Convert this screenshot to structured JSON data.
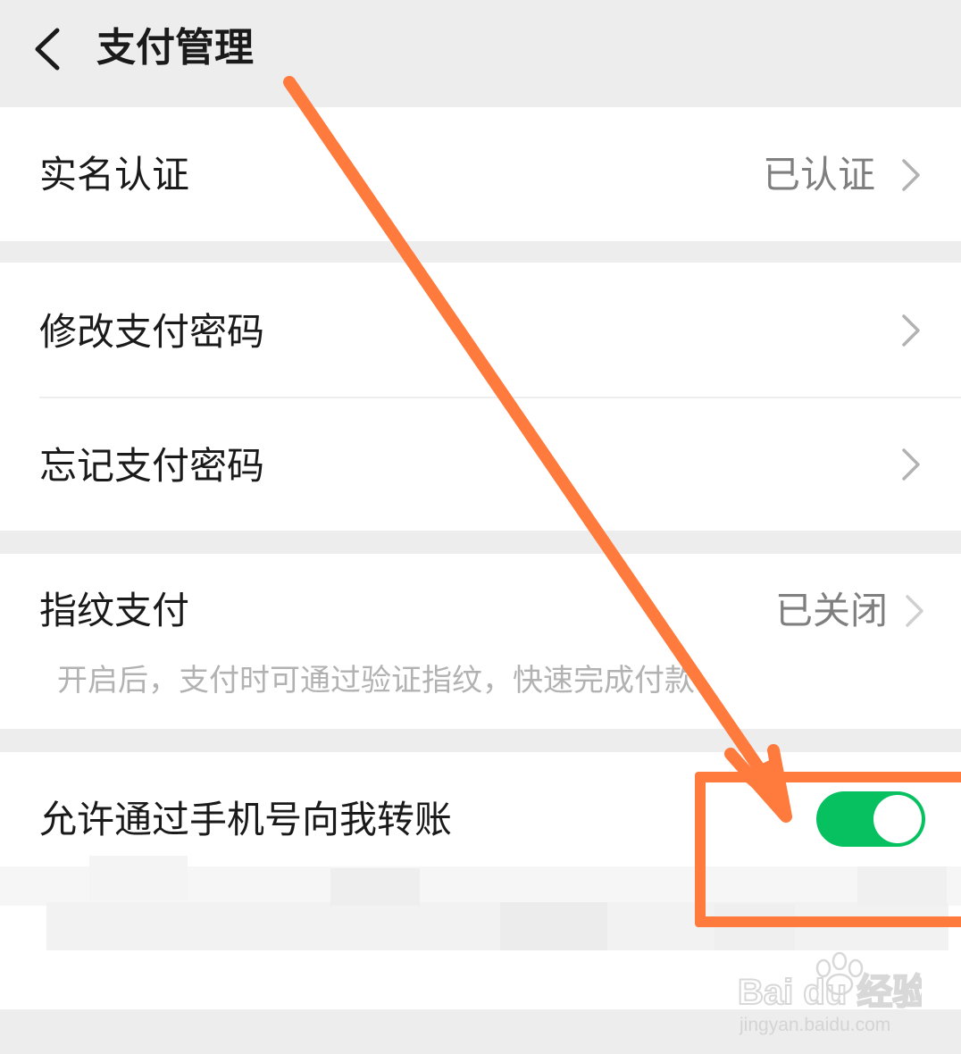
{
  "header": {
    "title": "支付管理",
    "back_icon": "chevron-left-icon"
  },
  "groups": {
    "identity": {
      "label": "实名认证",
      "value": "已认证"
    },
    "password": {
      "change_label": "修改支付密码",
      "forgot_label": "忘记支付密码"
    },
    "fingerprint": {
      "label": "指纹支付",
      "value": "已关闭",
      "description": "开启后，支付时可通过验证指纹，快速完成付款"
    },
    "transfer": {
      "label": "允许通过手机号向我转账",
      "toggle_on": true
    }
  },
  "colors": {
    "accent_green": "#07c160",
    "annotation_orange": "#ff7a3d",
    "background": "#ededed"
  },
  "watermark": {
    "brand": "Bai du 经验",
    "url": "jingyan.baidu.com"
  }
}
